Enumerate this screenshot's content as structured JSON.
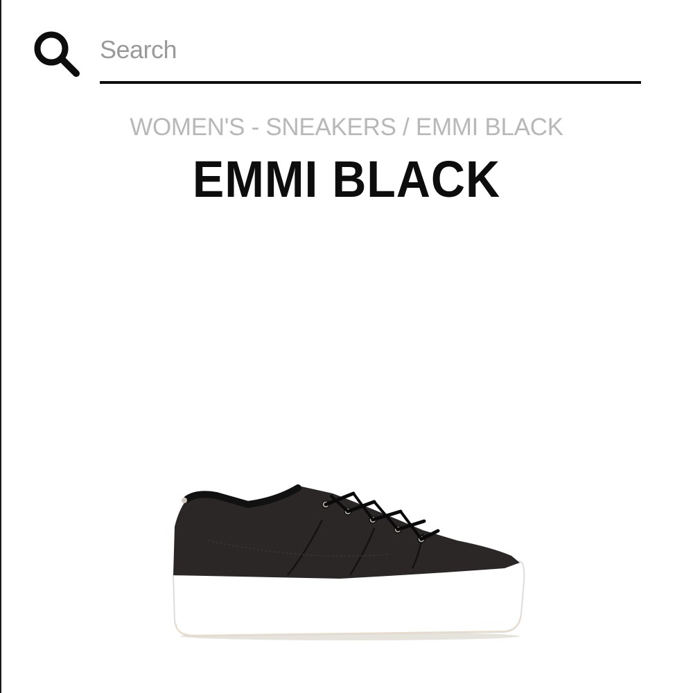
{
  "search": {
    "placeholder": "Search",
    "value": ""
  },
  "breadcrumb": {
    "items": [
      "WOMEN'S",
      "SNEAKERS",
      "EMMI BLACK"
    ],
    "separators": [
      " - ",
      " / "
    ]
  },
  "product": {
    "title": "EMMI BLACK",
    "image_alt": "Emmi black canvas platform sneaker"
  },
  "icons": {
    "search": "search-icon"
  },
  "colors": {
    "text_primary": "#0d0d0d",
    "breadcrumb": "#b8b8b8",
    "placeholder": "#9a9a9a",
    "shoe_upper": "#2b2726",
    "shoe_sole": "#ffffff"
  }
}
